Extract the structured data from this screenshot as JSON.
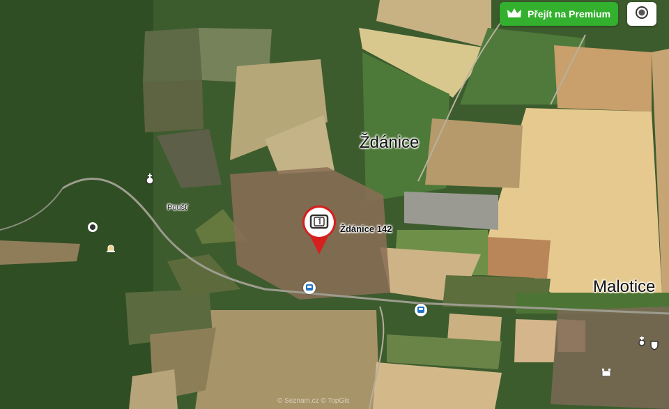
{
  "toolbar": {
    "premium_label": "Přejít na Premium",
    "premium_icon": "crown-icon",
    "layer_icon": "target-icon"
  },
  "places": {
    "town_zdanice": "Ždánice",
    "town_malotice": "Malotice",
    "hamlet_poust": "Poušť",
    "address": "Ždánice 142"
  },
  "copyright": "© Seznam.cz  © TopGis",
  "colors": {
    "premium_green": "#33b12e",
    "pin_red": "#d61f1f",
    "bus_blue": "#1e73c8"
  }
}
